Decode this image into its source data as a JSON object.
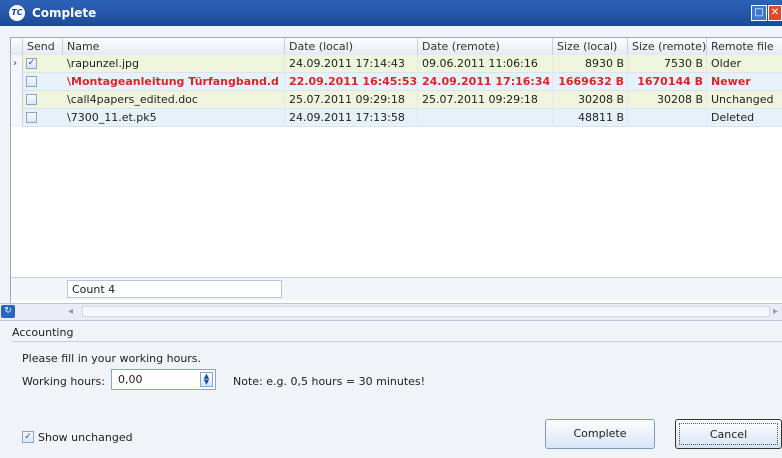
{
  "window": {
    "title": "Complete",
    "icon_text": "TC"
  },
  "grid": {
    "columns": [
      "Send",
      "Name",
      "Date (local)",
      "Date (remote)",
      "Size (local)",
      "Size (remote)",
      "Remote file"
    ],
    "rows": [
      {
        "send": true,
        "name": "\\rapunzel.jpg",
        "date_local": "24.09.2011 17:14:43",
        "date_remote": "09.06.2011 11:06:16",
        "size_local": "8930 B",
        "size_remote": "7530 B",
        "remote_file": "Older",
        "highlight": false,
        "current": true
      },
      {
        "send": false,
        "name": "\\Montageanleitung Türfangband.d",
        "date_local": "22.09.2011 16:45:53",
        "date_remote": "24.09.2011 17:16:34",
        "size_local": "1669632 B",
        "size_remote": "1670144 B",
        "remote_file": "Newer",
        "highlight": true,
        "current": false
      },
      {
        "send": false,
        "name": "\\call4papers_edited.doc",
        "date_local": "25.07.2011 09:29:18",
        "date_remote": "25.07.2011 09:29:18",
        "size_local": "30208 B",
        "size_remote": "30208 B",
        "remote_file": "Unchanged",
        "highlight": false,
        "current": false
      },
      {
        "send": false,
        "name": "\\7300_11.et.pk5",
        "date_local": "24.09.2011 17:13:58",
        "date_remote": "",
        "size_local": "48811 B",
        "size_remote": "",
        "remote_file": "Deleted",
        "highlight": false,
        "current": false
      }
    ],
    "footer": {
      "count": "Count 4"
    }
  },
  "accounting": {
    "header": "Accounting",
    "instruction": "Please fill in your working hours.",
    "working_hours_label": "Working hours:",
    "working_hours_value": "0,00",
    "note": "Note: e.g. 0,5 hours = 30 minutes!"
  },
  "show_unchanged": {
    "label": "Show unchanged",
    "checked": true
  },
  "buttons": {
    "complete": "Complete",
    "cancel": "Cancel"
  },
  "colors": {
    "row_even": "#eef5dc",
    "row_odd": "#e6f1fa",
    "accent": "#1c4a98",
    "newer_red": "#d9262a"
  }
}
